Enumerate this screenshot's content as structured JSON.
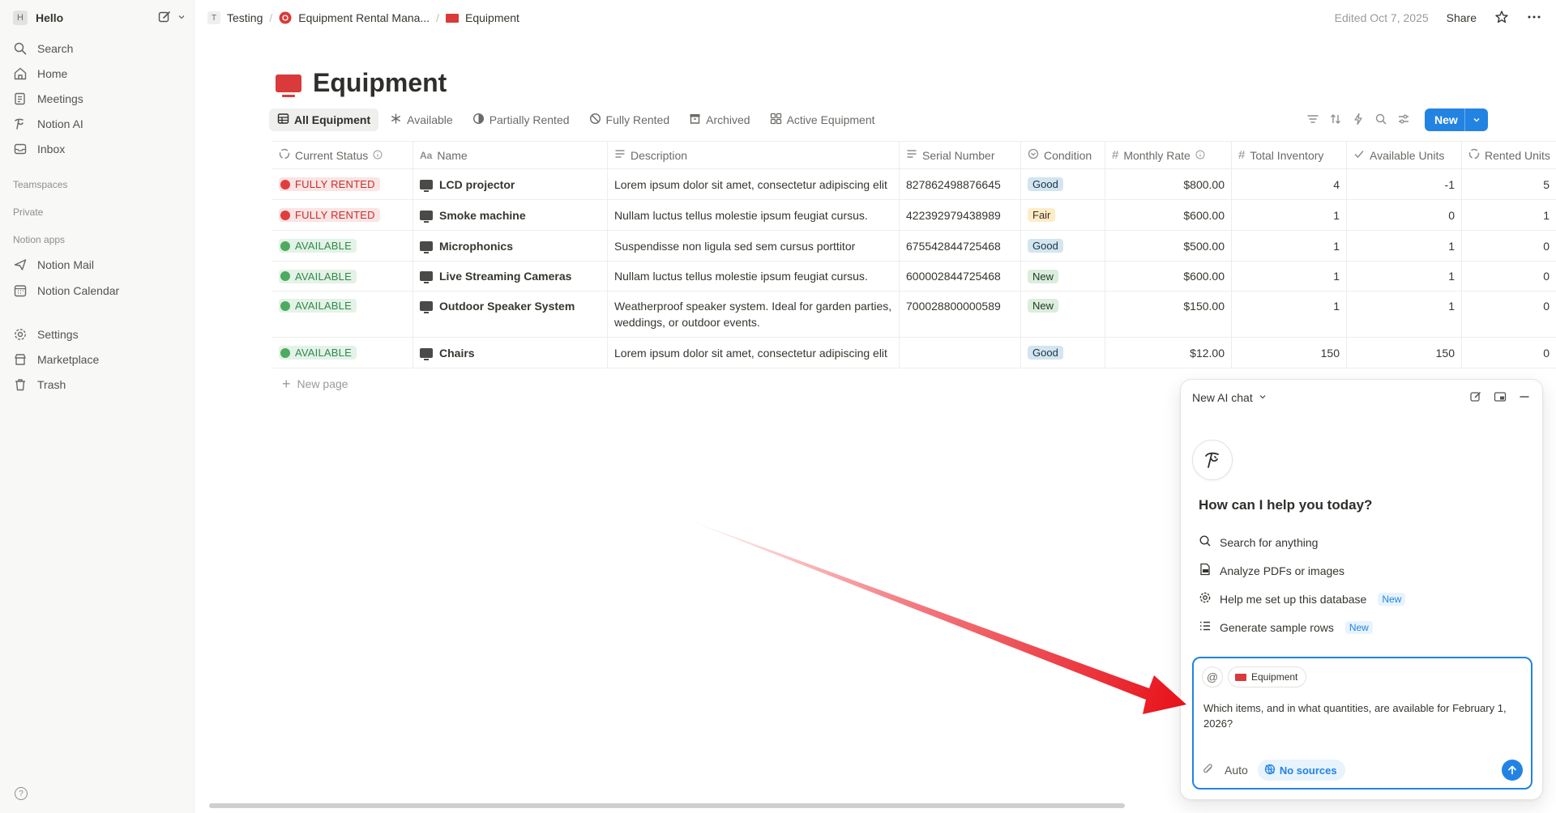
{
  "workspace": {
    "initial": "H",
    "name": "Hello"
  },
  "sidebar": {
    "nav": [
      {
        "label": "Search",
        "icon": "search-icon"
      },
      {
        "label": "Home",
        "icon": "home-icon"
      },
      {
        "label": "Meetings",
        "icon": "meetings-icon"
      },
      {
        "label": "Notion AI",
        "icon": "notion-ai-icon"
      },
      {
        "label": "Inbox",
        "icon": "inbox-icon"
      }
    ],
    "sections": {
      "teamspaces": "Teamspaces",
      "private": "Private",
      "apps": "Notion apps"
    },
    "apps": [
      {
        "label": "Notion Mail",
        "icon": "mail-icon"
      },
      {
        "label": "Notion Calendar",
        "icon": "calendar-icon"
      }
    ],
    "footer": [
      {
        "label": "Settings",
        "icon": "gear-icon"
      },
      {
        "label": "Marketplace",
        "icon": "marketplace-icon"
      },
      {
        "label": "Trash",
        "icon": "trash-icon"
      }
    ]
  },
  "breadcrumb": [
    {
      "icon_text": "T",
      "label": "Testing"
    },
    {
      "label": "Equipment Rental Mana..."
    },
    {
      "label": "Equipment"
    }
  ],
  "topbar": {
    "edited": "Edited Oct 7, 2025",
    "share": "Share"
  },
  "page": {
    "title": "Equipment"
  },
  "views": [
    {
      "label": "All Equipment",
      "active": true
    },
    {
      "label": "Available"
    },
    {
      "label": "Partially Rented"
    },
    {
      "label": "Fully Rented"
    },
    {
      "label": "Archived"
    },
    {
      "label": "Active Equipment"
    }
  ],
  "toolbar": {
    "new_label": "New"
  },
  "table": {
    "headers": {
      "status": "Current Status",
      "name": "Name",
      "desc": "Description",
      "serial": "Serial Number",
      "cond": "Condition",
      "rate": "Monthly Rate",
      "inv": "Total Inventory",
      "avail": "Available Units",
      "rented": "Rented Units"
    },
    "rows": [
      {
        "status": "FULLY RENTED",
        "name": "LCD projector",
        "desc": "Lorem ipsum dolor sit amet, consectetur adipiscing elit",
        "serial": "827862498876645",
        "cond": "Good",
        "rate": "$800.00",
        "inv": "4",
        "avail": "-1",
        "rented": "5"
      },
      {
        "status": "FULLY RENTED",
        "name": "Smoke machine",
        "desc": "Nullam luctus tellus molestie ipsum feugiat cursus.",
        "serial": "422392979438989",
        "cond": "Fair",
        "rate": "$600.00",
        "inv": "1",
        "avail": "0",
        "rented": "1"
      },
      {
        "status": "AVAILABLE",
        "name": "Microphonics",
        "desc": "Suspendisse non ligula sed sem cursus porttitor",
        "serial": "675542844725468",
        "cond": "Good",
        "rate": "$500.00",
        "inv": "1",
        "avail": "1",
        "rented": "0"
      },
      {
        "status": "AVAILABLE",
        "name": "Live Streaming Cameras",
        "desc": "Nullam luctus tellus molestie ipsum feugiat cursus.",
        "serial": "600002844725468",
        "cond": "New",
        "rate": "$600.00",
        "inv": "1",
        "avail": "1",
        "rented": "0"
      },
      {
        "status": "AVAILABLE",
        "name": "Outdoor Speaker System",
        "desc_line1": "Weatherproof speaker system. Ideal for garden parties,",
        "desc_line2": "weddings, or outdoor events.",
        "serial": "700028800000589",
        "cond": "New",
        "rate": "$150.00",
        "inv": "1",
        "avail": "1",
        "rented": "0"
      },
      {
        "status": "AVAILABLE",
        "name": "Chairs",
        "desc": "Lorem ipsum dolor sit amet, consectetur adipiscing elit",
        "serial": "",
        "cond": "Good",
        "rate": "$12.00",
        "inv": "150",
        "avail": "150",
        "rented": "0"
      }
    ],
    "new_page": "New page"
  },
  "ai_chat": {
    "title": "New AI chat",
    "question": "How can I help you today?",
    "suggestions": [
      {
        "label": "Search for anything",
        "icon": "search-icon"
      },
      {
        "label": "Analyze PDFs or images",
        "icon": "pdf-icon"
      },
      {
        "label": "Help me set up this database",
        "icon": "gear-icon",
        "badge": "New"
      },
      {
        "label": "Generate sample rows",
        "icon": "list-icon",
        "badge": "New"
      }
    ],
    "context_chip": "Equipment",
    "prompt": "Which items, and in what quantities, are available for February 1, 2026?",
    "mode": "Auto",
    "sources": "No sources"
  },
  "colors": {
    "accent": "#2383e2",
    "brand_red": "#d93a3a",
    "rented": "#e03e3e",
    "available": "#4dab5f",
    "annotation_arrow": "#e8121b"
  }
}
